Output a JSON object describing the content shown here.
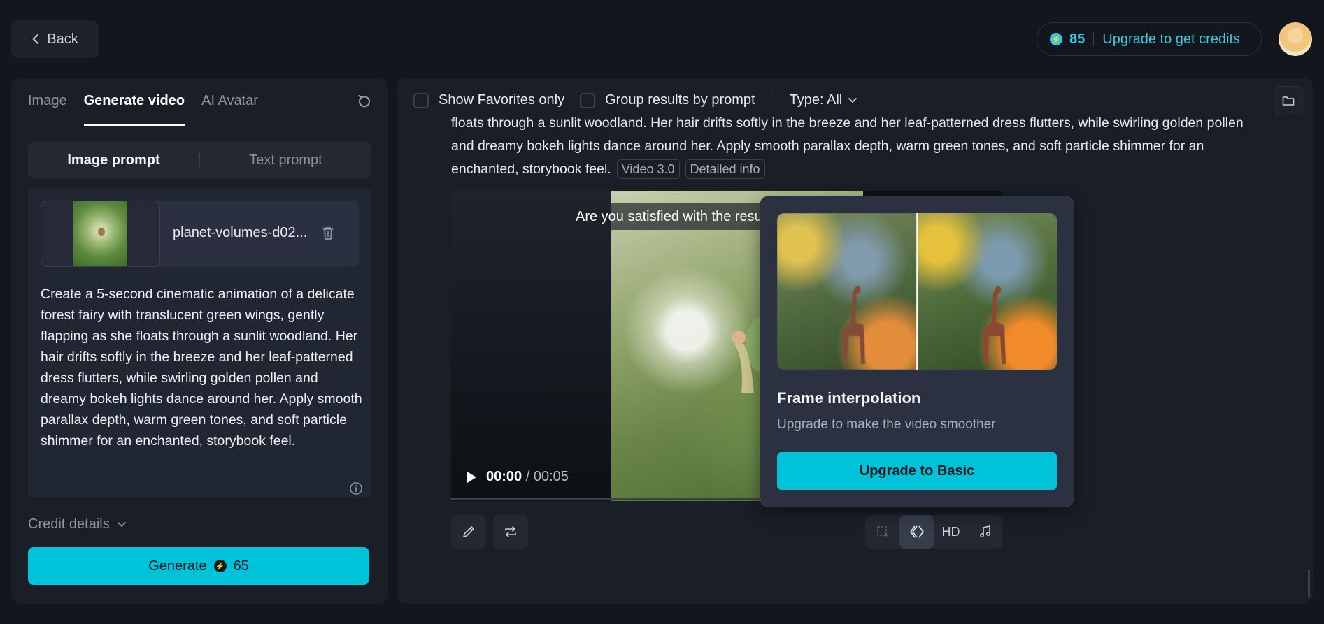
{
  "header": {
    "back_label": "Back",
    "credits_count": "85",
    "upgrade_label": "Upgrade to get credits"
  },
  "left_panel": {
    "tabs": [
      {
        "label": "Image"
      },
      {
        "label": "Generate video"
      },
      {
        "label": "AI Avatar"
      }
    ],
    "active_tab": "Generate video",
    "prompt_modes": [
      {
        "label": "Image prompt"
      },
      {
        "label": "Text prompt"
      }
    ],
    "active_mode": "Image prompt",
    "file_name": "planet-volumes-d02...",
    "prompt_text": "Create a 5-second cinematic animation of a delicate forest fairy with translucent green wings, gently flapping as she floats through a sunlit woodland. Her hair drifts softly in the breeze and her leaf-patterned dress flutters, while swirling golden pollen and dreamy bokeh lights dance around her. Apply smooth parallax depth, warm green tones, and soft particle shimmer for an enchanted, storybook feel.",
    "credit_details_label": "Credit details",
    "generate_label": "Generate",
    "generate_cost": "65"
  },
  "right_panel": {
    "filters": {
      "favorites_label": "Show Favorites only",
      "group_label": "Group results by prompt",
      "type_label": "Type: All"
    },
    "history": {
      "line1": "floats through a sunlit woodland. Her hair drifts softly in the breeze and her leaf-patterned dress flutters, while swirling golden pollen",
      "line2": "and dreamy bokeh lights dance around her. Apply smooth parallax depth, warm green tones, and soft particle shimmer for an",
      "line3": "enchanted, storybook feel.",
      "model_tag": "Video 3.0",
      "details_tag": "Detailed info"
    },
    "video": {
      "satisfaction_prompt": "Are you satisfied with the resu",
      "current_time": "00:00",
      "separator": "/",
      "duration": "00:05"
    },
    "tools": {
      "hd_label": "HD"
    }
  },
  "popover": {
    "title": "Frame interpolation",
    "subtitle": "Upgrade to make the video smoother",
    "button_label": "Upgrade to Basic"
  },
  "colors": {
    "accent": "#00c2d8",
    "background": "#13161d",
    "panel": "#1a1e26"
  }
}
